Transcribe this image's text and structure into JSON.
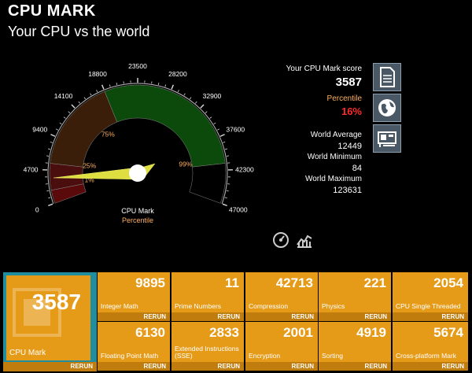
{
  "header": {
    "title": "CPU MARK",
    "subtitle": "Your CPU vs the world"
  },
  "gauge": {
    "ticks": [
      "0",
      "4700",
      "9400",
      "14100",
      "18800",
      "23500",
      "28200",
      "32900",
      "37600",
      "42300",
      "47000"
    ],
    "percent_marks": [
      "1%",
      "25%",
      "75%",
      "99%"
    ],
    "center_label": "CPU Mark",
    "center_sublabel": "Percentile",
    "needle_value": 3587,
    "max": 47000
  },
  "stats": {
    "score_label": "Your CPU Mark score",
    "score": "3587",
    "percentile_label": "Percentile",
    "percentile": "16%",
    "avg_label": "World Average",
    "avg": "12449",
    "min_label": "World Minimum",
    "min": "84",
    "max_label": "World Maximum",
    "max": "123631"
  },
  "main_tile": {
    "value": "3587",
    "label": "CPU Mark",
    "rerun": "RERUN"
  },
  "tiles": [
    {
      "value": "9895",
      "label": "Integer Math",
      "rerun": "RERUN"
    },
    {
      "value": "11",
      "label": "Prime Numbers",
      "rerun": "RERUN"
    },
    {
      "value": "42713",
      "label": "Compression",
      "rerun": "RERUN"
    },
    {
      "value": "221",
      "label": "Physics",
      "rerun": "RERUN"
    },
    {
      "value": "2054",
      "label": "CPU Single Threaded",
      "rerun": "RERUN"
    },
    {
      "value": "6130",
      "label": "Floating Point Math",
      "rerun": "RERUN"
    },
    {
      "value": "2833",
      "label": "Extended Instructions (SSE)",
      "rerun": "RERUN"
    },
    {
      "value": "2001",
      "label": "Encryption",
      "rerun": "RERUN"
    },
    {
      "value": "4919",
      "label": "Sorting",
      "rerun": "RERUN"
    },
    {
      "value": "5674",
      "label": "Cross-platform Mark",
      "rerun": "RERUN"
    }
  ],
  "icons": {
    "side": [
      "document-icon",
      "globe-icon",
      "hardware-card-icon"
    ],
    "bottom": [
      "speedometer-icon",
      "chart-icon"
    ]
  },
  "colors": {
    "tile": "#e69b18",
    "tile_footer": "#c07c0c",
    "selected_border": "#1f8fa0",
    "percentile": "#ff2a2a"
  }
}
